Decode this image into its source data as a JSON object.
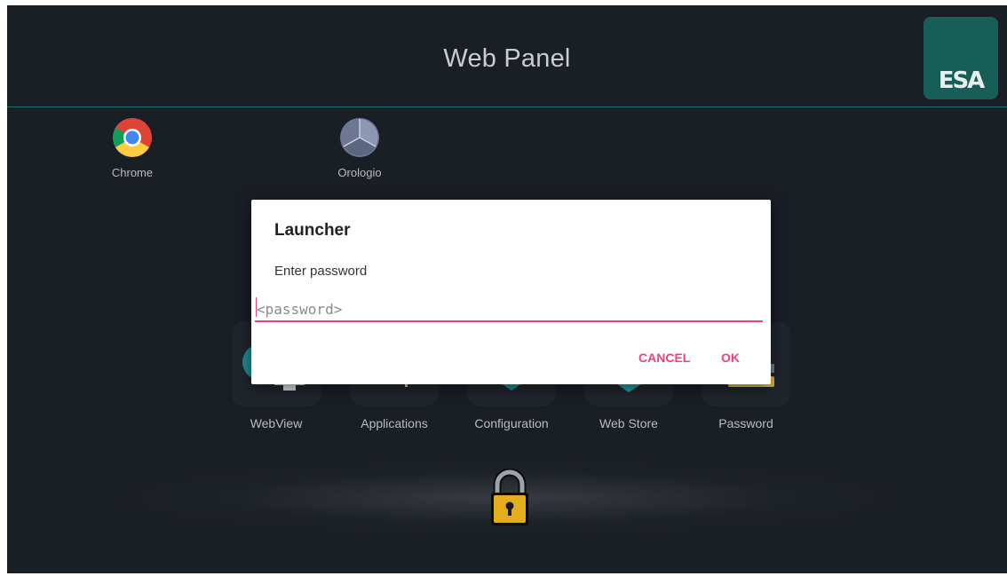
{
  "header": {
    "title": "Web Panel",
    "logo_text": "ESA"
  },
  "desktop": {
    "icons": [
      {
        "label": "Chrome",
        "icon": "chrome-icon"
      },
      {
        "label": "Orologio",
        "icon": "clock-icon"
      }
    ]
  },
  "dock": {
    "items": [
      {
        "label": "WebView",
        "icon": "globe-monitor-icon"
      },
      {
        "label": "Applications",
        "icon": "apps-icon"
      },
      {
        "label": "Configuration",
        "icon": "settings-icon"
      },
      {
        "label": "Web Store",
        "icon": "store-icon"
      },
      {
        "label": "Password",
        "icon": "key-icon"
      }
    ]
  },
  "lock": {
    "icon": "padlock-icon"
  },
  "dialog": {
    "title": "Launcher",
    "message": "Enter password",
    "password_placeholder": "<password>",
    "password_value": "",
    "cancel_label": "CANCEL",
    "ok_label": "OK"
  },
  "colors": {
    "background": "#1a1e25",
    "accent": "#f0407d",
    "brand": "#175e58",
    "header_line": "#1e6f74"
  }
}
